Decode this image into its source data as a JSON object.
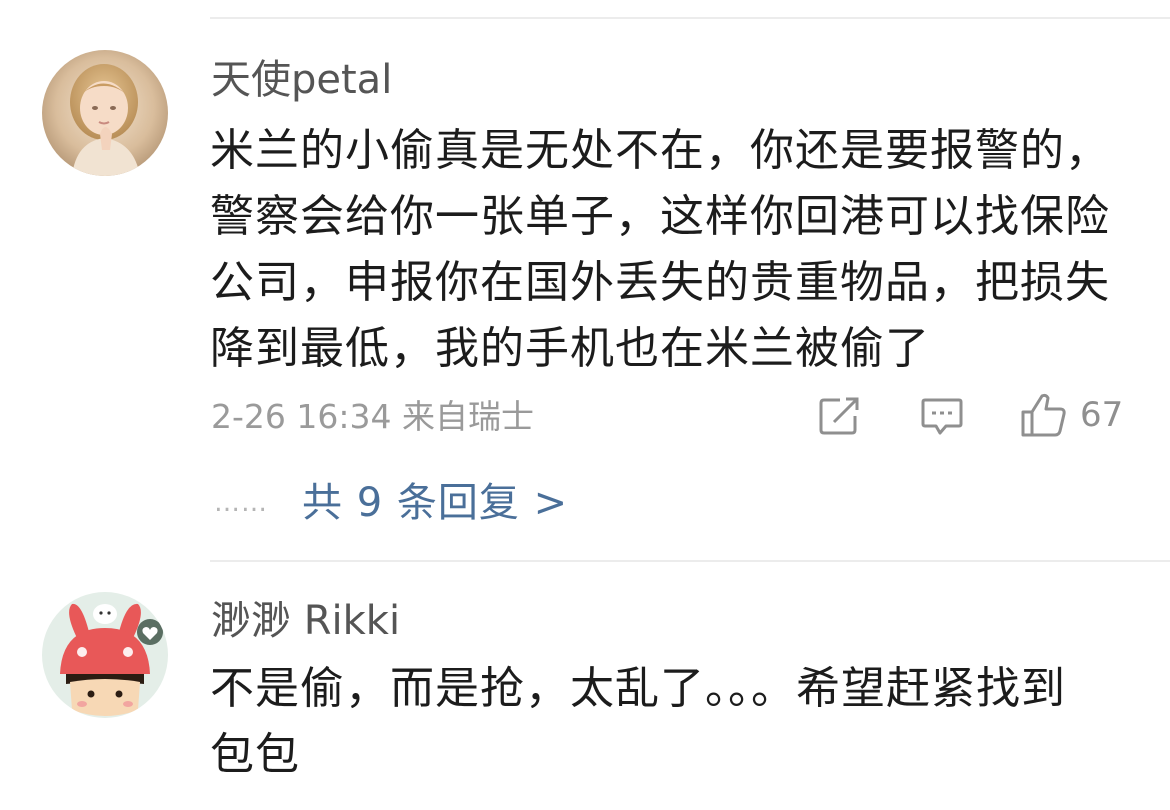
{
  "comments": [
    {
      "username": "天使petal",
      "lines": [
        "米兰的小偷真是无处不在，你还是要报警的，",
        "警察会给你一张单子，这样你回港可以找保险",
        "公司，申报你在国外丢失的贵重物品，把损失",
        "降到最低，我的手机也在米兰被偷了"
      ],
      "meta": "2-26 16:34  来自瑞士",
      "like_count": "67",
      "replies_dots": "……",
      "replies_link": "共 9 条回复 >"
    },
    {
      "username": "渺渺 Rikki",
      "lines": [
        "不是偷，而是抢，太乱了。。。希望赶紧找到",
        "包包"
      ]
    }
  ],
  "icons": {
    "repost": "repost-icon",
    "comment": "comment-icon",
    "like": "thumbs-up-icon"
  },
  "colors": {
    "reply_link": "#4a6f99",
    "meta_gray": "#9a9a9a",
    "username_gray": "#555555"
  }
}
